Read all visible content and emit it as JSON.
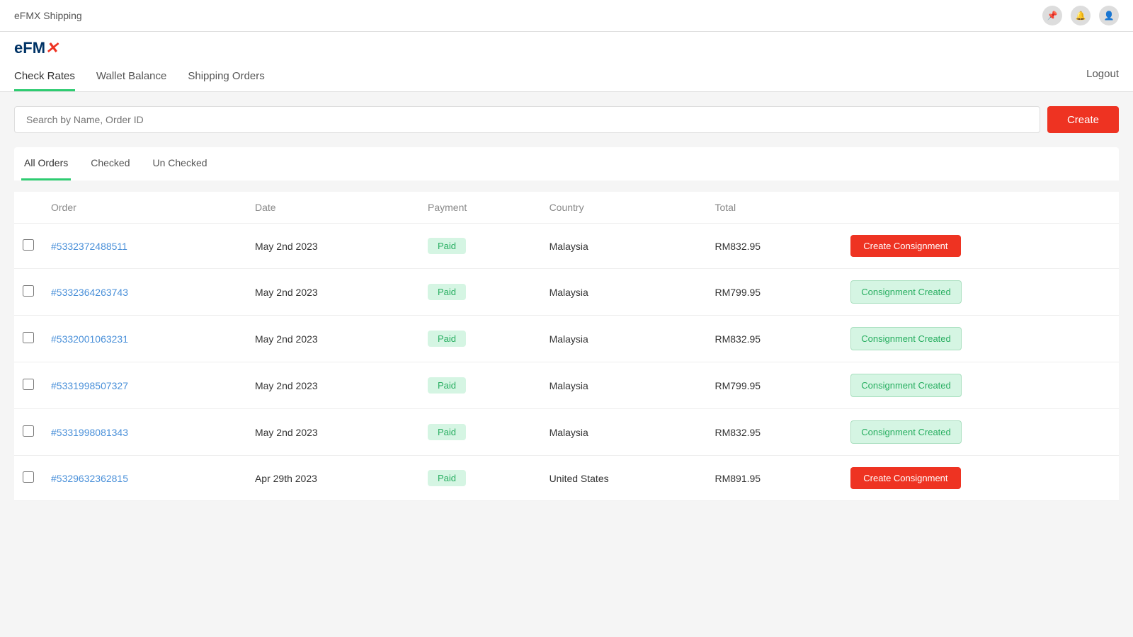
{
  "topBar": {
    "title": "eFMX Shipping",
    "pinIcon": "📌"
  },
  "logo": {
    "text": "eFMX",
    "suffix": "✕"
  },
  "nav": {
    "tabs": [
      {
        "id": "check-rates",
        "label": "Check Rates",
        "active": true
      },
      {
        "id": "wallet-balance",
        "label": "Wallet Balance",
        "active": false
      },
      {
        "id": "shipping-orders",
        "label": "Shipping Orders",
        "active": false
      }
    ],
    "logout": "Logout"
  },
  "search": {
    "placeholder": "Search by Name, Order ID",
    "createLabel": "Create"
  },
  "filterTabs": [
    {
      "id": "all-orders",
      "label": "All Orders",
      "active": true
    },
    {
      "id": "checked",
      "label": "Checked",
      "active": false
    },
    {
      "id": "unchecked",
      "label": "Un Checked",
      "active": false
    }
  ],
  "table": {
    "columns": [
      "",
      "Order",
      "Date",
      "Payment",
      "Country",
      "Total",
      ""
    ],
    "rows": [
      {
        "id": "row-1",
        "orderId": "#5332372488511",
        "date": "May 2nd 2023",
        "payment": "Paid",
        "country": "Malaysia",
        "total": "RM832.95",
        "actionType": "create",
        "actionLabel": "Create Consignment"
      },
      {
        "id": "row-2",
        "orderId": "#5332364263743",
        "date": "May 2nd 2023",
        "payment": "Paid",
        "country": "Malaysia",
        "total": "RM799.95",
        "actionType": "created",
        "actionLabel": "Consignment Created"
      },
      {
        "id": "row-3",
        "orderId": "#5332001063231",
        "date": "May 2nd 2023",
        "payment": "Paid",
        "country": "Malaysia",
        "total": "RM832.95",
        "actionType": "created",
        "actionLabel": "Consignment Created"
      },
      {
        "id": "row-4",
        "orderId": "#5331998507327",
        "date": "May 2nd 2023",
        "payment": "Paid",
        "country": "Malaysia",
        "total": "RM799.95",
        "actionType": "created",
        "actionLabel": "Consignment Created"
      },
      {
        "id": "row-5",
        "orderId": "#5331998081343",
        "date": "May 2nd 2023",
        "payment": "Paid",
        "country": "Malaysia",
        "total": "RM832.95",
        "actionType": "created",
        "actionLabel": "Consignment Created"
      },
      {
        "id": "row-6",
        "orderId": "#5329632362815",
        "date": "Apr 29th 2023",
        "payment": "Paid",
        "country": "United States",
        "total": "RM891.95",
        "actionType": "create",
        "actionLabel": "Create Consignment"
      }
    ]
  }
}
